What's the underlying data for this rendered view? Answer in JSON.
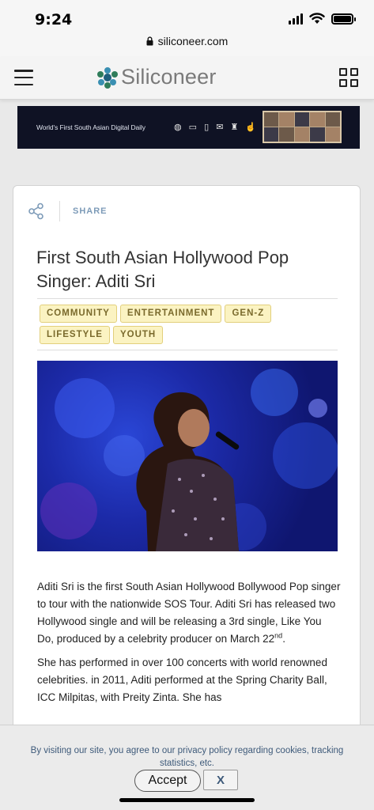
{
  "status_bar": {
    "time": "9:24",
    "icons": [
      "cellular-signal-icon",
      "wifi-icon",
      "battery-icon"
    ]
  },
  "browser": {
    "url": "siliconeer.com",
    "lock_icon": "lock-icon"
  },
  "header": {
    "logo_text": "Siliconeer",
    "menu_icon": "hamburger-menu-icon",
    "apps_icon": "grid-icon"
  },
  "banner": {
    "text": "World's First South Asian Digital Daily",
    "device_icons": "◍ ▭ ▯ ✉ ♜ ☝"
  },
  "article": {
    "share_label": "SHARE",
    "title": "First South Asian Hollywood Pop Singer: Aditi Sri",
    "tags": [
      "COMMUNITY",
      "ENTERTAINMENT",
      "GEN-Z",
      "LIFESTYLE",
      "YOUTH"
    ],
    "paragraph_1": "Aditi Sri is the first South Asian Hollywood Bollywood Pop singer to tour with the nationwide SOS Tour. Aditi Sri has released two Hollywood single and will be releasing a 3rd single, Like You Do, produced by a celebrity producer on March 22",
    "paragraph_1_sup": "nd",
    "paragraph_1_end": ".",
    "paragraph_2": "She has performed in over 100 concerts with world renowned celebrities. in 2011, Aditi performed at the Spring Charity Ball, ICC Milpitas, with Preity Zinta. She has"
  },
  "cookie_bar": {
    "text": "By visiting our site, you agree to our privacy policy regarding cookies, tracking statistics, etc.",
    "accept_label": "Accept",
    "close_label": "X"
  },
  "colors": {
    "tag_bg": "#fbf3c2",
    "tag_text": "#7a6a2c",
    "share_blue": "#7d9bb8",
    "banner_bg": "#0f1224",
    "hero_blue": "#1c2aa8"
  }
}
